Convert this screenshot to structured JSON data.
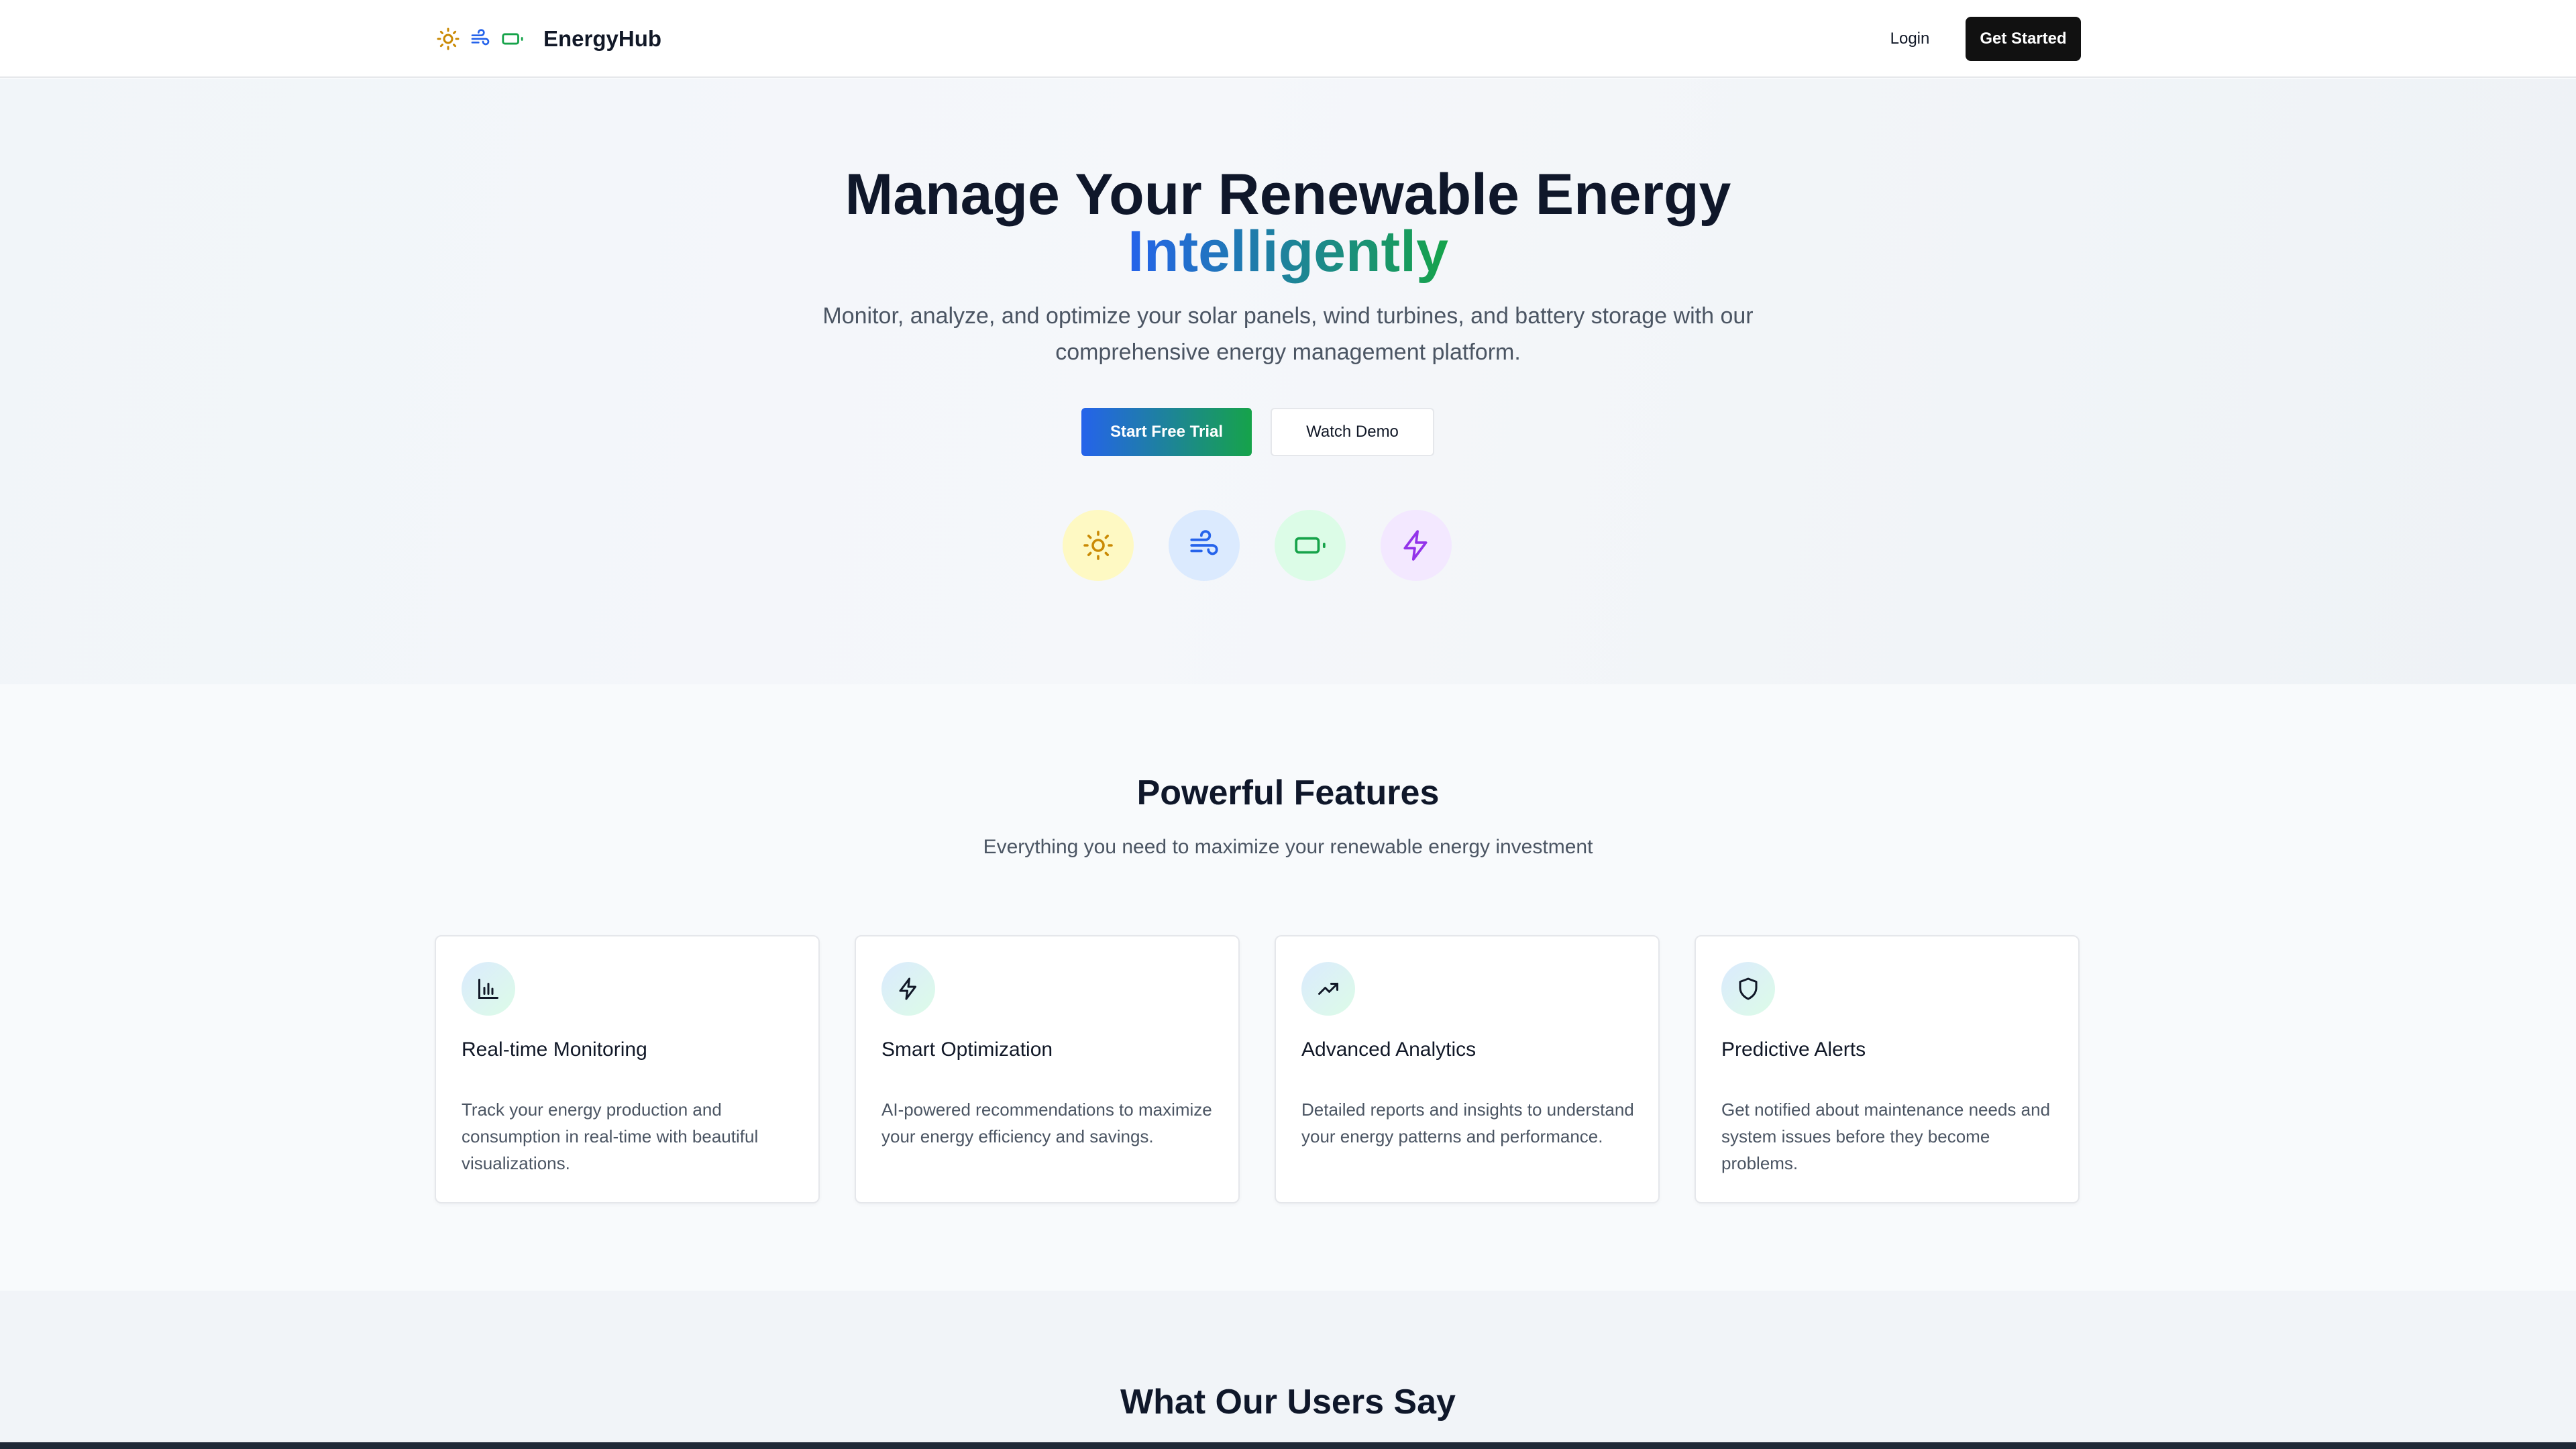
{
  "header": {
    "brand_name": "EnergyHub",
    "brand_icons": [
      "sun-icon",
      "wind-icon",
      "battery-icon"
    ],
    "login_label": "Login",
    "get_started_label": "Get Started"
  },
  "hero": {
    "title": "Manage Your Renewable Energy",
    "highlight": "Intelligently",
    "subtitle": "Monitor, analyze, and optimize your solar panels, wind turbines, and battery storage with our comprehensive energy management platform.",
    "primary_cta": "Start Free Trial",
    "secondary_cta": "Watch Demo",
    "energy_icons": [
      {
        "name": "sun-icon",
        "color": "#ca8a04",
        "bg": "#fef9c3"
      },
      {
        "name": "wind-icon",
        "color": "#2563eb",
        "bg": "#dbeafe"
      },
      {
        "name": "battery-icon",
        "color": "#16a34a",
        "bg": "#dcfce7"
      },
      {
        "name": "zap-icon",
        "color": "#9333ea",
        "bg": "#f3e8ff"
      }
    ]
  },
  "features": {
    "title": "Powerful Features",
    "subtitle": "Everything you need to maximize your renewable energy investment",
    "cards": [
      {
        "icon": "bar-chart-icon",
        "title": "Real-time Monitoring",
        "description": "Track your energy production and consumption in real-time with beautiful visualizations."
      },
      {
        "icon": "zap-icon",
        "title": "Smart Optimization",
        "description": "AI-powered recommendations to maximize your energy efficiency and savings."
      },
      {
        "icon": "trending-up-icon",
        "title": "Advanced Analytics",
        "description": "Detailed reports and insights to understand your energy patterns and performance."
      },
      {
        "icon": "shield-icon",
        "title": "Predictive Alerts",
        "description": "Get notified about maintenance needs and system issues before they become problems."
      }
    ]
  },
  "testimonials": {
    "title": "What Our Users Say"
  },
  "colors": {
    "gradient_start": "#2563eb",
    "gradient_end": "#16a34a",
    "dark_button": "#111111"
  }
}
